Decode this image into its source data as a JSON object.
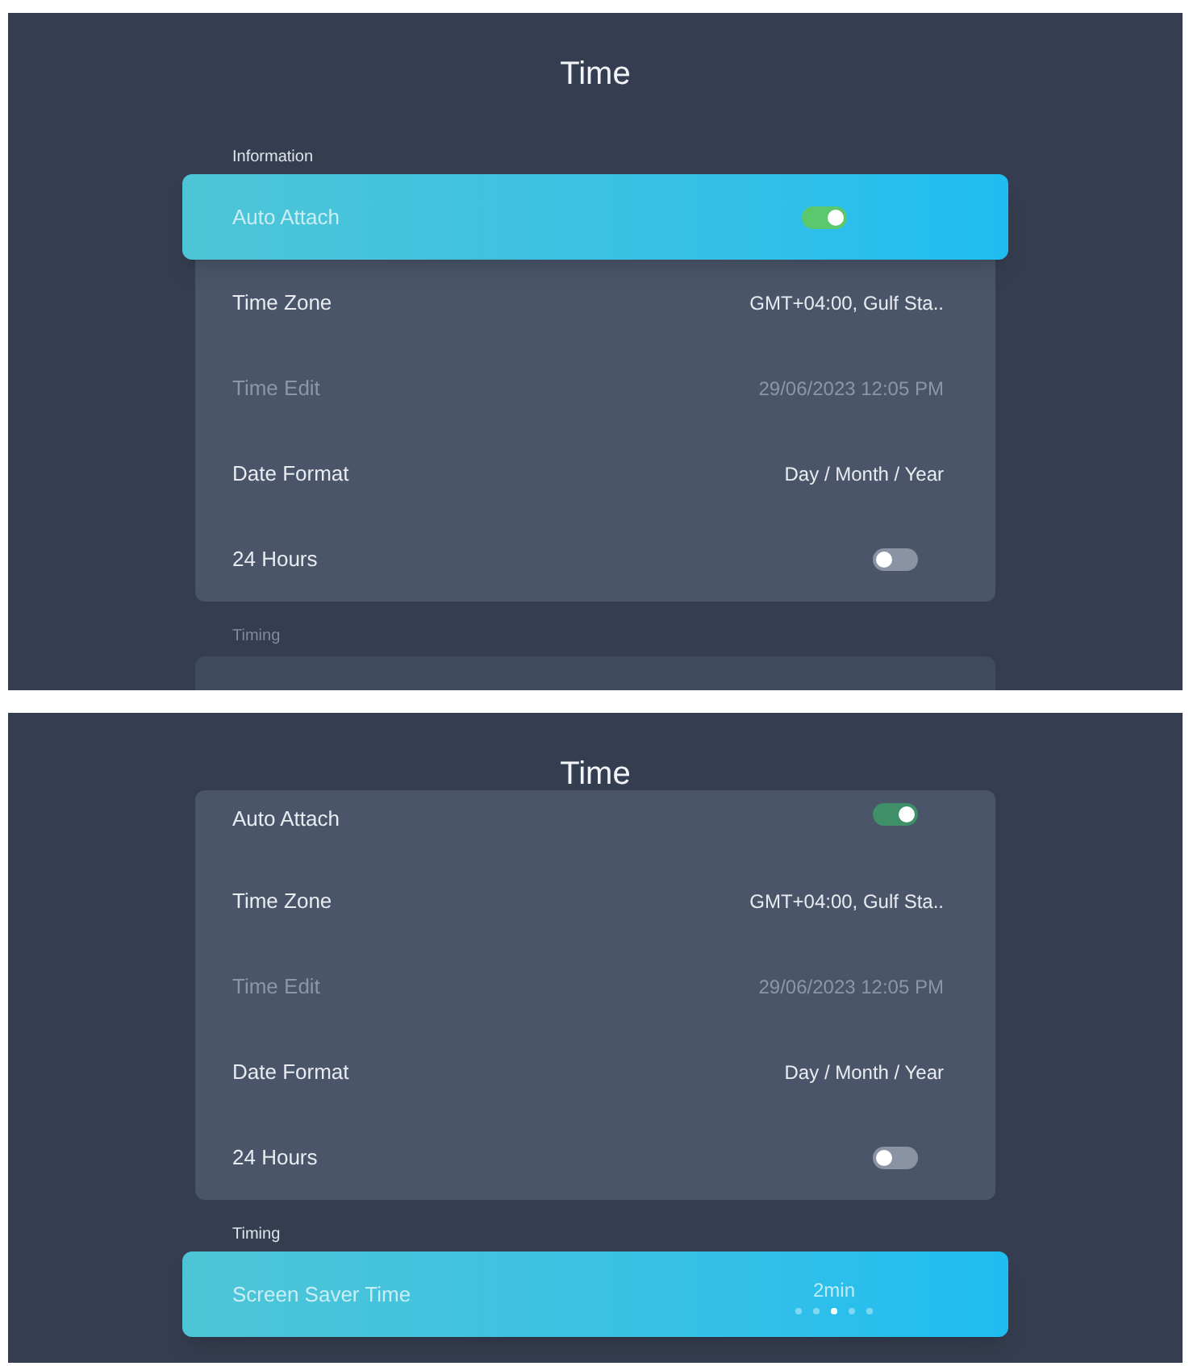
{
  "screens": [
    {
      "title": "Time",
      "scrolled": false,
      "sections": [
        {
          "label": "Information",
          "faded": false,
          "items": [
            {
              "kind": "toggle",
              "label": "Auto Attach",
              "on": true,
              "selected": true,
              "disabled": false
            },
            {
              "kind": "value",
              "label": "Time Zone",
              "value": "GMT+04:00, Gulf Sta..",
              "selected": false,
              "disabled": false
            },
            {
              "kind": "value",
              "label": "Time Edit",
              "value": "29/06/2023 12:05 PM",
              "selected": false,
              "disabled": true
            },
            {
              "kind": "value",
              "label": "Date Format",
              "value": "Day / Month / Year",
              "selected": false,
              "disabled": false
            },
            {
              "kind": "toggle",
              "label": "24 Hours",
              "on": false,
              "selected": false,
              "disabled": false
            }
          ]
        },
        {
          "label": "Timing",
          "faded": true
        }
      ]
    },
    {
      "title": "Time",
      "scrolled": true,
      "sections": [
        {
          "items": [
            {
              "kind": "toggle",
              "label": "Auto Attach",
              "on": true,
              "selected": false,
              "disabled": false
            },
            {
              "kind": "value",
              "label": "Time Zone",
              "value": "GMT+04:00, Gulf Sta..",
              "selected": false,
              "disabled": false
            },
            {
              "kind": "value",
              "label": "Time Edit",
              "value": "29/06/2023 12:05 PM",
              "selected": false,
              "disabled": true
            },
            {
              "kind": "value",
              "label": "Date Format",
              "value": "Day / Month / Year",
              "selected": false,
              "disabled": false
            },
            {
              "kind": "toggle",
              "label": "24 Hours",
              "on": false,
              "selected": false,
              "disabled": false
            }
          ]
        },
        {
          "label": "Timing",
          "faded": false,
          "items": [
            {
              "kind": "pager",
              "label": "Screen Saver Time",
              "value": "2min",
              "selected": true,
              "disabled": false,
              "pages": [
                {
                  "selected": false
                },
                {
                  "selected": false
                },
                {
                  "selected": true
                },
                {
                  "selected": false
                },
                {
                  "selected": false
                }
              ]
            }
          ]
        }
      ]
    }
  ]
}
